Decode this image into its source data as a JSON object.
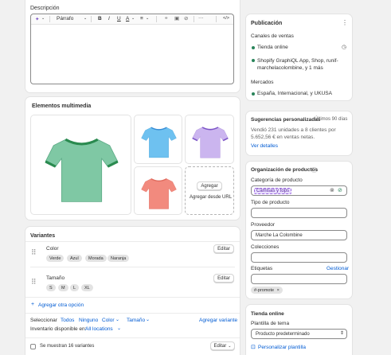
{
  "description": {
    "label": "Descripción",
    "toolbar": {
      "format": "Párrafo",
      "bold": "B",
      "italic": "I",
      "underline": "U",
      "color": "A",
      "align": "≡",
      "more": "···",
      "code": "</>"
    }
  },
  "media": {
    "title": "Elementos multimedia",
    "add_button": "Agregar",
    "add_url": "Agregar desde URL",
    "shirt_colors": [
      "#7fc8a4",
      "#6ec1f0",
      "#cbb5ef",
      "#f28a7e"
    ],
    "collar_colors": [
      "#2a8a4f",
      "#3a8ed6",
      "#7d55c7",
      "#e06b5e"
    ]
  },
  "variants": {
    "title": "Variantes",
    "options": [
      {
        "name": "Color",
        "edit": "Editar",
        "values": [
          "Verde",
          "Azul",
          "Morada",
          "Naranja"
        ]
      },
      {
        "name": "Tamaño",
        "edit": "Editar",
        "values": [
          "S",
          "M",
          "L",
          "XL"
        ]
      }
    ],
    "add_option": "Agregar otra opción",
    "filter": {
      "select_label": "Seleccionar",
      "all": "Todos",
      "none": "Ninguno",
      "color": "Color",
      "size": "Tamaño",
      "add_variant": "Agregar variante"
    },
    "inventory": {
      "label": "Inventario disponible en:",
      "value": "All locations"
    },
    "footer": {
      "showing": "Se muestran 16 variantes",
      "edit": "Editar"
    }
  },
  "publication": {
    "title": "Publicación",
    "channels_label": "Canales de ventas",
    "channels": [
      "Tienda online",
      "Shopify GraphiQL App, Shop, runif-marchelacolombine, y 1 más"
    ],
    "markets_label": "Mercados",
    "markets": [
      "España, Internacional, y UKUSA"
    ]
  },
  "insights": {
    "title": "Sugerencias personalizadas",
    "period": "Últimos 90 días",
    "text": "Vendió 231 unidades a 8 clientes por 5.652,56 € en ventas netas.",
    "link": "Ver detalles"
  },
  "organization": {
    "title": "Organización de productos",
    "category_label": "Categoría de producto",
    "category_value": "Camisas y tops",
    "type_label": "Tipo de producto",
    "type_value": "",
    "vendor_label": "Proveedor",
    "vendor_value": "Marche La Colombine",
    "collections_label": "Colecciones",
    "collections_value": "",
    "tags_label": "Etiquetas",
    "tags_manage": "Gestionar",
    "tags_value": "",
    "tag_chip": "#-promote"
  },
  "online_store": {
    "title": "Tienda online",
    "template_label": "Plantilla de tema",
    "template_value": "Producto predeterminado",
    "customize": "Personalizar plantilla"
  },
  "colors": {
    "accent": "#005bd3",
    "success": "#29845a"
  }
}
